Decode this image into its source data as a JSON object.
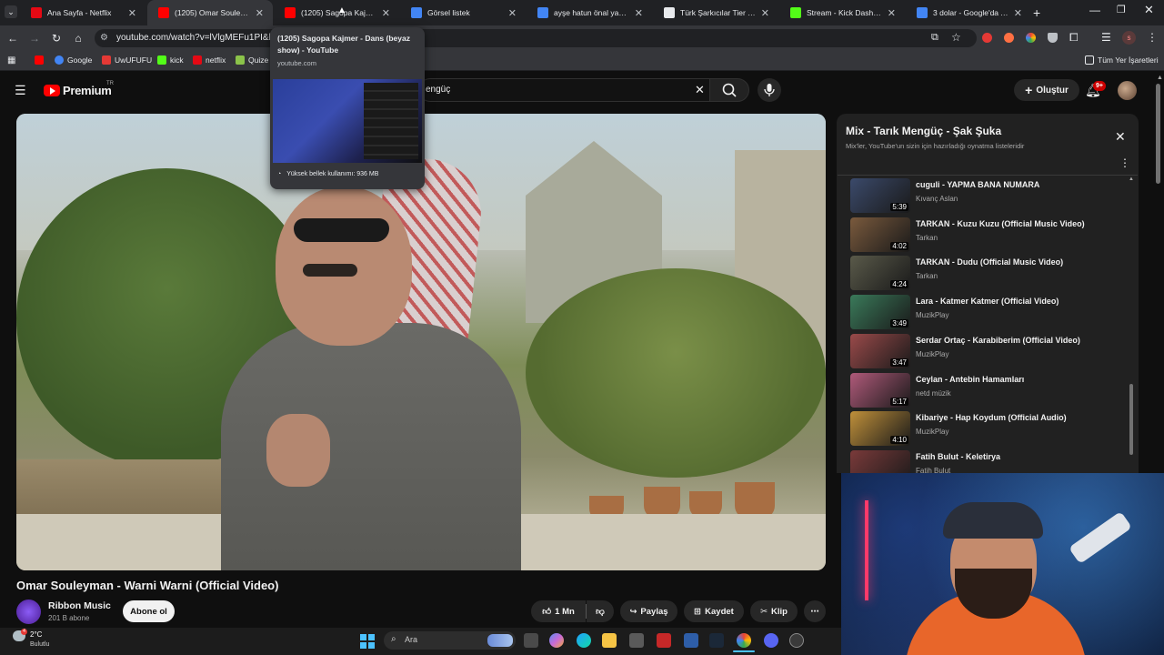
{
  "browser": {
    "tabs": [
      {
        "title": "Ana Sayfa - Netflix",
        "favicon_color": "#e50914",
        "active": false
      },
      {
        "title": "(1205) Omar Souleyman -",
        "favicon_color": "#ff0000",
        "active": true
      },
      {
        "title": "(1205) Sagopa Kajmer - D",
        "favicon_color": "#ff0000",
        "active": false
      },
      {
        "title": "Görsel listek",
        "favicon_color": "#4285f4",
        "active": false
      },
      {
        "title": "ayşe hatun önal yaş - Goo",
        "favicon_color": "#4285f4",
        "active": false
      },
      {
        "title": "Türk Şarkıcılar Tier List (C",
        "favicon_color": "#e8eaed",
        "active": false
      },
      {
        "title": "Stream - Kick Dashboard",
        "favicon_color": "#53fc18",
        "active": false
      },
      {
        "title": "3 dolar - Google'da Ara",
        "favicon_color": "#4285f4",
        "active": false
      }
    ],
    "new_tab": "+",
    "url": "youtube.com/watch?v=lVlgMEFu1PI&list",
    "bookmarks": [
      {
        "label": "",
        "color": "#ff0000"
      },
      {
        "label": "Google",
        "color": "#4285f4"
      },
      {
        "label": "UwUFUFU",
        "color": "#e53935"
      },
      {
        "label": "kick",
        "color": "#53fc18"
      },
      {
        "label": "netflix",
        "color": "#e50914"
      },
      {
        "label": "Quize",
        "color": "#8bc34a"
      }
    ],
    "all_bookmarks": "Tüm Yer İşaretleri"
  },
  "hovercard": {
    "title": "(1205) Sagopa Kajmer - Dans (beyaz show) - YouTube",
    "domain": "youtube.com",
    "memory": "Yüksek bellek kullanımı: 936 MB"
  },
  "youtube": {
    "logo_text": "Premium",
    "logo_badge": "TR",
    "search_value": "engüç",
    "create_label": "Oluştur",
    "notification_badge": "9+",
    "video_title": "Omar Souleyman - Warni Warni (Official Video)",
    "channel_name": "Ribbon Music",
    "channel_subs": "201 B abone",
    "subscribe_label": "Abone ol",
    "like_count": "1 Mn",
    "share_label": "Paylaş",
    "save_label": "Kaydet",
    "clip_label": "Klip"
  },
  "playlist": {
    "title": "Mix - Tarık Mengüç - Şak Şuka",
    "subtitle": "Mix'ler, YouTube'un sizin için hazırladığı oynatma listeleridir",
    "items": [
      {
        "title": "cuguli - YAPMA BANA NUMARA",
        "artist": "Kıvanç Aslan",
        "duration": "5:39",
        "thumb": "#3b4a6b"
      },
      {
        "title": "TARKAN - Kuzu Kuzu (Official Music Video)",
        "artist": "Tarkan",
        "duration": "4:02",
        "thumb": "#7a5a3d"
      },
      {
        "title": "TARKAN - Dudu (Official Music Video)",
        "artist": "Tarkan",
        "duration": "4:24",
        "thumb": "#5a5a4a"
      },
      {
        "title": "Lara - Katmer Katmer (Official Video)",
        "artist": "MuzikPlay",
        "duration": "3:49",
        "thumb": "#3a7a5a"
      },
      {
        "title": "Serdar Ortaç - Karabiberim (Official Video)",
        "artist": "MuzikPlay",
        "duration": "3:47",
        "thumb": "#9a4a4a"
      },
      {
        "title": "Ceylan - Antebin Hamamları",
        "artist": "netd müzik",
        "duration": "5:17",
        "thumb": "#b05a7a"
      },
      {
        "title": "Kibariye - Hap Koydum (Official Audio)",
        "artist": "MuzikPlay",
        "duration": "4:10",
        "thumb": "#c0903a"
      },
      {
        "title": "Fatih Bulut - Keletirya",
        "artist": "Fatih Bulut",
        "duration": "3:48",
        "thumb": "#7a3a3a"
      }
    ]
  },
  "taskbar": {
    "weather_temp": "2°C",
    "weather_desc": "Bulutlu",
    "search_placeholder": "Ara"
  }
}
